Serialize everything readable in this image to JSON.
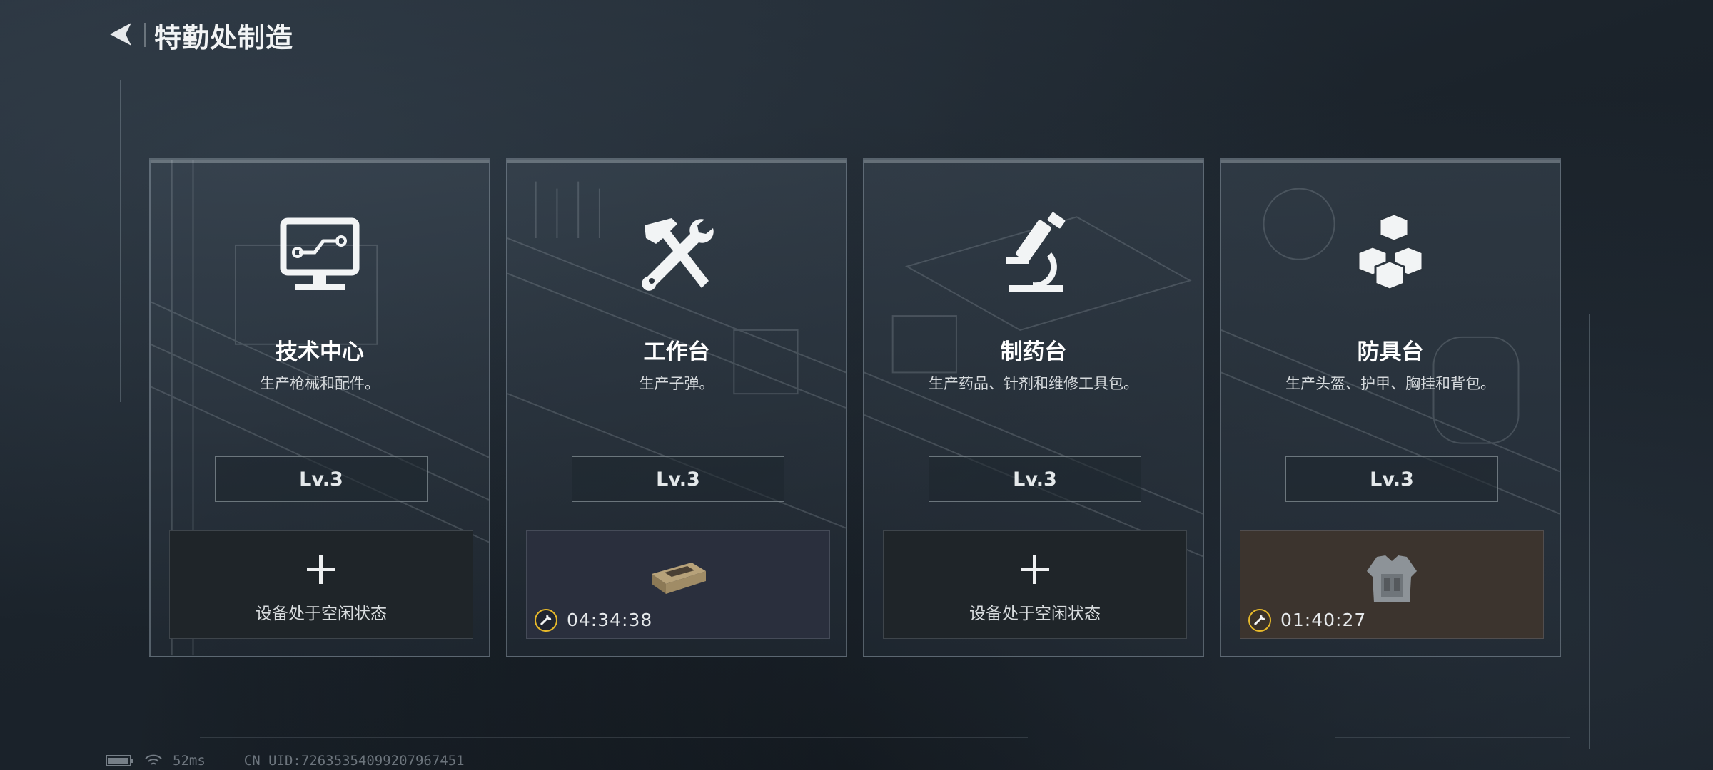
{
  "header": {
    "title": "特勤处制造"
  },
  "cards": [
    {
      "name": "技术中心",
      "desc": "生产枪械和配件。",
      "level": "Lv.3",
      "icon": "monitor-circuit-icon",
      "slot": {
        "state": "idle",
        "text": "设备处于空闲状态"
      }
    },
    {
      "name": "工作台",
      "desc": "生产子弹。",
      "level": "Lv.3",
      "icon": "hammer-wrench-icon",
      "slot": {
        "state": "busy",
        "timer": "04:34:38",
        "item": "ammo-box-icon"
      }
    },
    {
      "name": "制药台",
      "desc": "生产药品、针剂和维修工具包。",
      "level": "Lv.3",
      "icon": "microscope-icon",
      "slot": {
        "state": "idle",
        "text": "设备处于空闲状态"
      }
    },
    {
      "name": "防具台",
      "desc": "生产头盔、护甲、胸挂和背包。",
      "level": "Lv.3",
      "icon": "cubes-icon",
      "slot": {
        "state": "busy",
        "timer": "01:40:27",
        "item": "body-armor-icon"
      }
    }
  ],
  "status": {
    "ping": "52ms",
    "uid": "CN UID:72635354099207967451"
  },
  "colors": {
    "background": "#1b232b",
    "timer_ring": "#e7b92a",
    "slot_blue": "#2a2f3d",
    "slot_brown": "#3c342e"
  }
}
